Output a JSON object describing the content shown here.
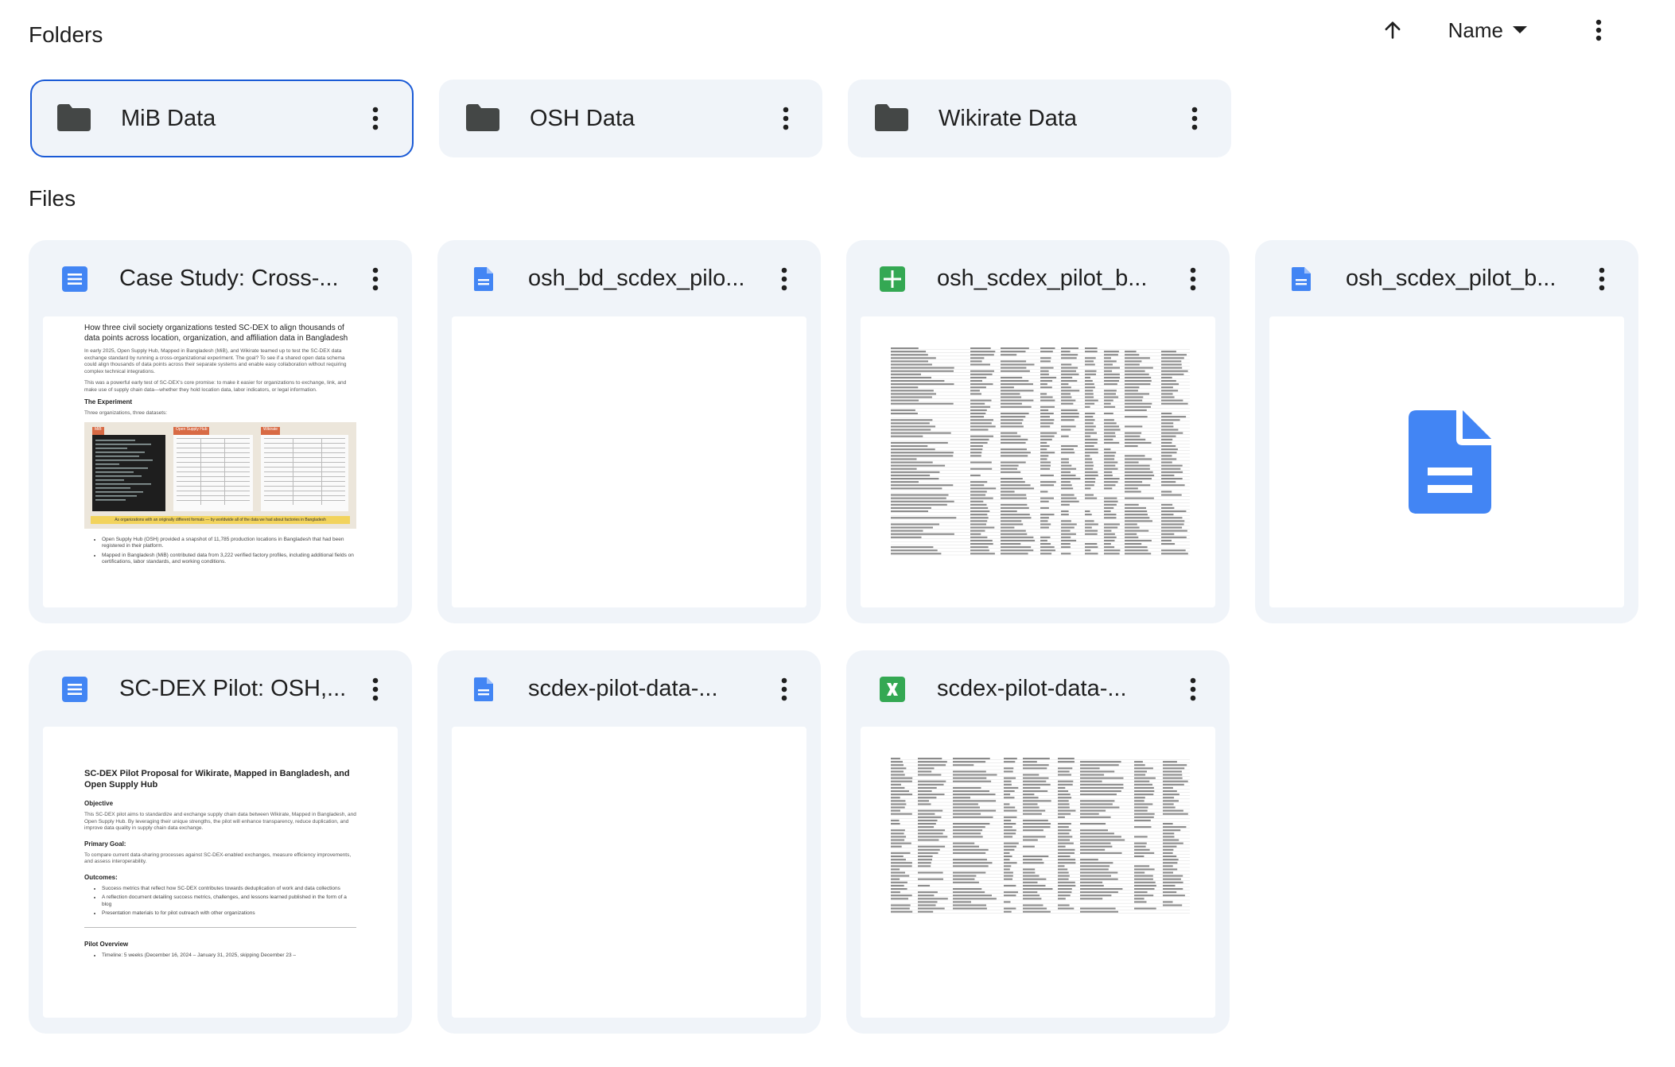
{
  "sections": {
    "folders_title": "Folders",
    "files_title": "Files"
  },
  "toolbar": {
    "sort_label": "Name",
    "sort_direction_icon": "arrow-up-icon",
    "sort_menu_icon": "caret-down-icon",
    "more_icon": "more-vert-icon"
  },
  "folders": [
    {
      "name": "MiB Data",
      "selected": true
    },
    {
      "name": "OSH Data",
      "selected": false
    },
    {
      "name": "Wikirate Data",
      "selected": false
    }
  ],
  "files": [
    {
      "name": "Case Study: Cross-...",
      "type": "google-doc",
      "icon_color": "#4285f4"
    },
    {
      "name": "osh_bd_scdex_pilo...",
      "type": "doc-file",
      "icon_color": "#4285f4"
    },
    {
      "name": "osh_scdex_pilot_b...",
      "type": "google-sheet",
      "icon_color": "#34a853"
    },
    {
      "name": "osh_scdex_pilot_b...",
      "type": "doc-file",
      "icon_color": "#4285f4"
    },
    {
      "name": "SC-DEX Pilot: OSH,...",
      "type": "google-doc",
      "icon_color": "#4285f4"
    },
    {
      "name": "scdex-pilot-data-...",
      "type": "doc-file",
      "icon_color": "#4285f4"
    },
    {
      "name": "scdex-pilot-data-...",
      "type": "excel-file",
      "icon_color": "#34a853"
    }
  ],
  "previews": {
    "case_study": {
      "heading": "How three civil society organizations tested SC-DEX to align thousands of data points across location, organization, and affiliation data in Bangladesh",
      "p1": "In early 2025, Open Supply Hub, Mapped in Bangladesh (MiB), and Wikirate teamed up to test the SC-DEX data exchange standard by running a cross-organizational experiment. The goal? To see if a shared open data schema could align thousands of data points across their separate systems and enable easy collaboration without requiring complex technical integrations.",
      "p2": "This was a powerful early test of SC-DEX's core promise: to make it easier for organizations to exchange, link, and make use of supply chain data—whether they hold location data, labor indicators, or legal information.",
      "experiment_title": "The Experiment",
      "experiment_sub": "Three organizations, three datasets:",
      "image_tabs": [
        "MiB",
        "Open Supply Hub",
        "Wikirate"
      ],
      "image_caption": "As organizations with an originally different formats — by worldwide all of the data we had about factories in Bangladesh",
      "bullets": [
        "Open Supply Hub (OSH) provided a snapshot of 11,785 production locations in Bangladesh that had been registered in their platform.",
        "Mapped in Bangladesh (MiB) contributed data from 3,222 verified factory profiles, including additional fields on certifications, labor standards, and working conditions."
      ]
    },
    "proposal": {
      "heading": "SC-DEX Pilot Proposal for Wikirate, Mapped in Bangladesh, and Open Supply Hub",
      "objective_title": "Objective",
      "objective": "This SC-DEX pilot aims to standardize and exchange supply chain data between Wikirate, Mapped in Bangladesh, and Open Supply Hub. By leveraging their unique strengths, the pilot will enhance transparency, reduce duplication, and improve data quality in supply chain data exchange.",
      "goal_title": "Primary Goal:",
      "goal": "To compare current data-sharing processes against SC-DEX-enabled exchanges, measure efficiency improvements, and assess interoperability.",
      "outcomes_title": "Outcomes:",
      "outcomes": [
        "Success metrics that reflect how SC-DEX contributes towards deduplication of work and data collections",
        "A reflection document detailing success metrics, challenges, and lessons learned published in the form of a blog",
        "Presentation materials to for pilot outreach with other organizations"
      ],
      "overview_title": "Pilot Overview",
      "timeline": "Timeline: 5 weeks (December 16, 2024 – January 31, 2025, skipping December 23 –"
    }
  }
}
